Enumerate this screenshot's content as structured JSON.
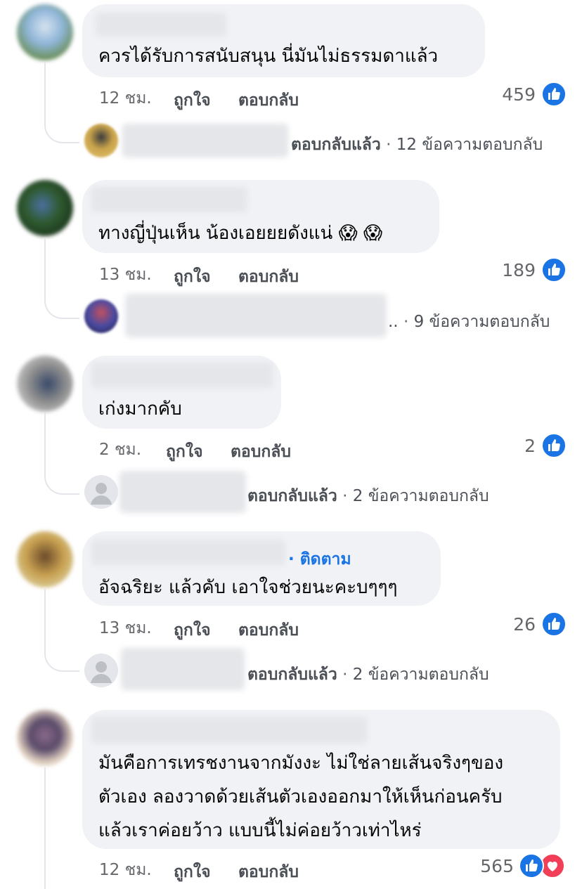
{
  "colors": {
    "accent": "#1b74e4",
    "love": "#f33e58",
    "bubble": "#f0f2f5",
    "meta": "#65676b"
  },
  "comments": [
    {
      "text": "ควรได้รับการสนับสนุน นี่มันไม่ธรรมดาแล้ว",
      "time": "12 ชม.",
      "like_label": "ถูกใจ",
      "reply_label": "ตอบกลับ",
      "reactions": "459",
      "reply_preview": {
        "lead": "ตอบกลับแล้ว",
        "sep": "·",
        "summary": "12 ข้อความตอบกลับ"
      }
    },
    {
      "text": "ทางญี่ปุ่นเห็น น้องเอยยยดังแน่ 😱 😱",
      "time": "13 ชม.",
      "like_label": "ถูกใจ",
      "reply_label": "ตอบกลับ",
      "reactions": "189",
      "reply_preview": {
        "lead": "..",
        "sep": "·",
        "summary": "9 ข้อความตอบกลับ"
      }
    },
    {
      "text": "เก่งมากคับ",
      "time": "2 ชม.",
      "like_label": "ถูกใจ",
      "reply_label": "ตอบกลับ",
      "reactions": "2",
      "reply_preview": {
        "lead": "ตอบกลับแล้ว",
        "sep": "·",
        "summary": "2 ข้อความตอบกลับ"
      }
    },
    {
      "follow": "· ติดตาม",
      "text": "อัจฉริยะ แล้วคับ เอาใจช่วยนะคะบๆๆๆ",
      "time": "13 ชม.",
      "like_label": "ถูกใจ",
      "reply_label": "ตอบกลับ",
      "reactions": "26",
      "reply_preview": {
        "lead": "ตอบกลับแล้ว",
        "sep": "·",
        "summary": "2 ข้อความตอบกลับ"
      }
    },
    {
      "lines": [
        "มันคือการเทรชงานจากมังงะ ไม่ใช่ลายเส้นจริงๆของ",
        "ตัวเอง ลองวาดด้วยเส้นตัวเองออกมาให้เห็นก่อนครับ",
        "แล้วเราค่อยว้าว แบบนี้ไม่ค่อยว้าวเท่าไหร่"
      ],
      "time": "12 ชม.",
      "like_label": "ถูกใจ",
      "reply_label": "ตอบกลับ",
      "reactions": "565"
    }
  ]
}
